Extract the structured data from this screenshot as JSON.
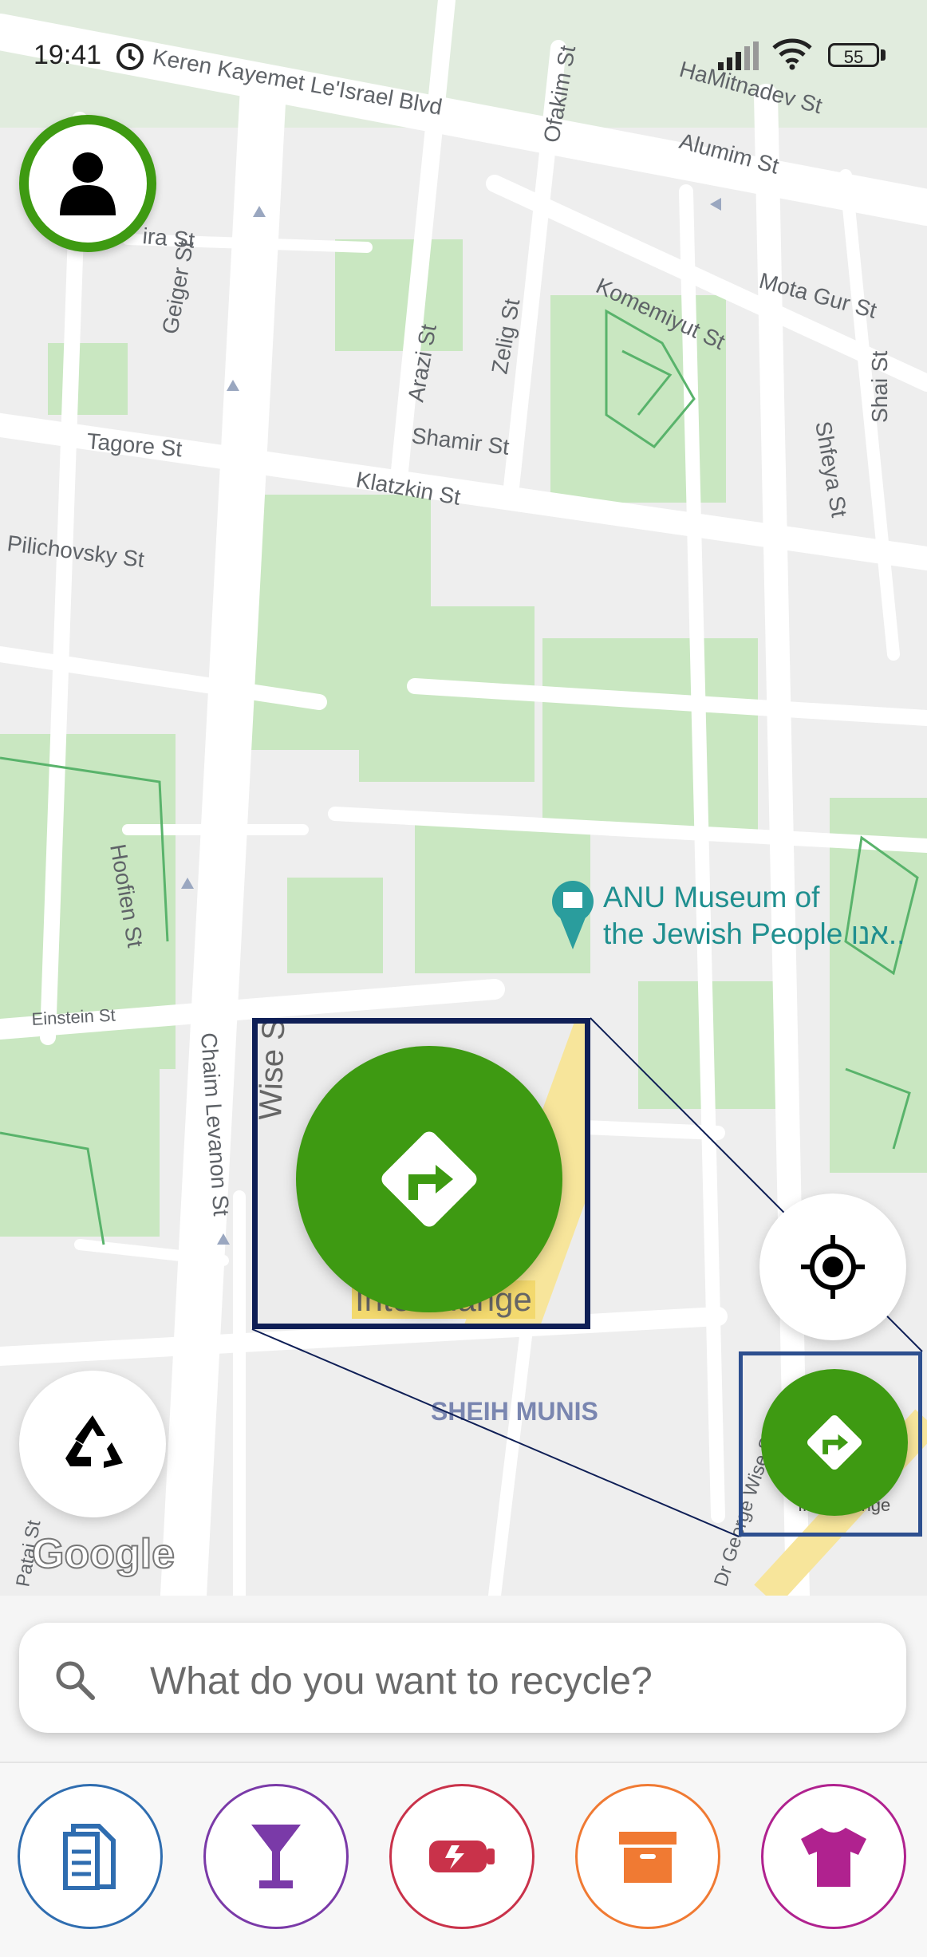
{
  "status_bar": {
    "time": "19:41",
    "battery": "55"
  },
  "map": {
    "streets": [
      "Keren Kayemet Le'Israel Blvd",
      "Ofakim St",
      "HaMitnadev St",
      "Alumim St",
      "Mota Gur St",
      "Komemiyut St",
      "Zelig St",
      "Arazi St",
      "Geiger St",
      "ira St",
      "Shamir St",
      "Tagore St",
      "Klatzkin St",
      "Shfeya St",
      "Shai St",
      "Pilichovsky St",
      "Hoofien St",
      "Einstein St",
      "Chaim Levanon St",
      "SHEIH MUNIS",
      "Dr George Wise St",
      "Patai St",
      "Wise St"
    ],
    "poi": {
      "line1": "ANU Museum of",
      "line2": "the Jewish People אנו.."
    },
    "attribution": "Google",
    "interchange_label": "Interchange",
    "zoom_interchange_label": "Interchange"
  },
  "icons": {
    "avatar": "person-icon",
    "recycle": "recycle-icon",
    "locate": "crosshair-icon",
    "directions": "turn-right-icon"
  },
  "search": {
    "placeholder": "What do you want to recycle?"
  },
  "categories": [
    {
      "name": "paper",
      "icon": "document-icon",
      "color": "#2f6db0"
    },
    {
      "name": "glass",
      "icon": "cocktail-glass-icon",
      "color": "#7a3aa8"
    },
    {
      "name": "batteries",
      "icon": "battery-icon",
      "color": "#c9324a"
    },
    {
      "name": "cardboard",
      "icon": "box-icon",
      "color": "#f07a33"
    },
    {
      "name": "textile",
      "icon": "tshirt-icon",
      "color": "#b0228f"
    }
  ],
  "colors": {
    "accent_green": "#3e9a12",
    "park_green": "#c8e6c0",
    "zoom_frame": "#0f1f56"
  }
}
